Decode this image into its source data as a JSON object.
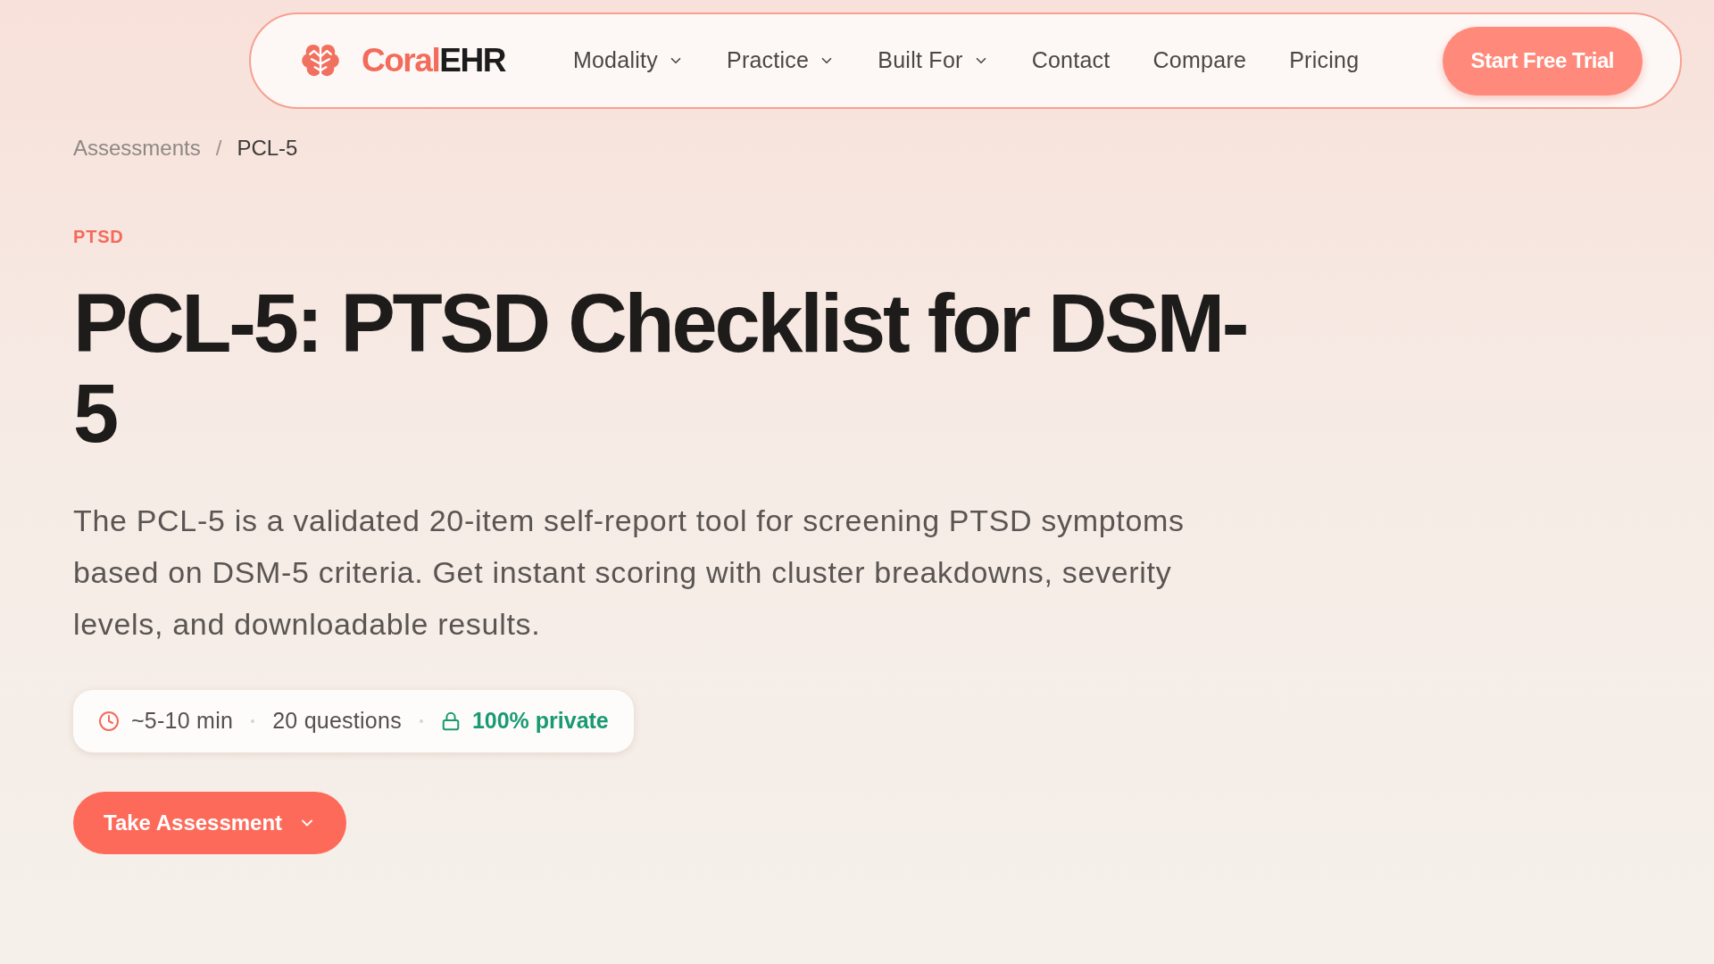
{
  "header": {
    "brand": {
      "accent": "Coral",
      "rest": "EHR"
    },
    "nav": [
      {
        "label": "Modality",
        "kind": "dropdown"
      },
      {
        "label": "Practice",
        "kind": "dropdown"
      },
      {
        "label": "Built For",
        "kind": "dropdown"
      },
      {
        "label": "Contact",
        "kind": "link"
      },
      {
        "label": "Compare",
        "kind": "link"
      },
      {
        "label": "Pricing",
        "kind": "link"
      }
    ],
    "cta_button": "Start Free Trial"
  },
  "breadcrumb": {
    "separator": "/",
    "items": [
      {
        "label": "Assessments",
        "current": false
      },
      {
        "label": "PCL-5",
        "current": true
      }
    ]
  },
  "hero": {
    "eyebrow": "PTSD",
    "title": "PCL-5: PTSD Checklist for DSM-5",
    "description": "The PCL-5 is a validated 20-item self-report tool for screening PTSD symptoms based on DSM-5 criteria. Get instant scoring with cluster breakdowns, severity levels, and downloadable results.",
    "meta": [
      {
        "kind": "time",
        "text": "~5-10 min"
      },
      {
        "kind": "count",
        "text": "20 questions"
      },
      {
        "kind": "privacy",
        "text": "100% private"
      }
    ],
    "primary_button": {
      "label": "Take Assessment",
      "kind": "dropdown"
    }
  }
}
